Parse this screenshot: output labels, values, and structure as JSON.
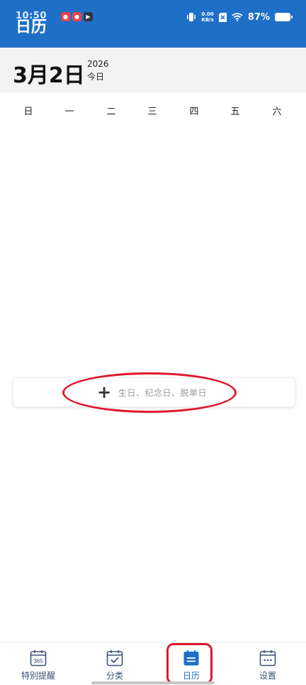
{
  "status_bar": {
    "time": "10:50",
    "net_speed": "0.00",
    "net_unit": "KB/s",
    "battery": "87%"
  },
  "app": {
    "title": "日历"
  },
  "date_header": {
    "big_date": "3月2日",
    "year": "2026",
    "today": "今日"
  },
  "weekdays": [
    "日",
    "一",
    "二",
    "三",
    "四",
    "五",
    "六"
  ],
  "add_card": {
    "plus": "+",
    "hint": "生日、纪念日、脱单日"
  },
  "bottom_nav": {
    "items": [
      {
        "label": "特别提醒",
        "icon": "calendar-365-icon"
      },
      {
        "label": "分类",
        "icon": "calendar-check-icon"
      },
      {
        "label": "日历",
        "icon": "calendar-list-icon",
        "active": true
      },
      {
        "label": "设置",
        "icon": "calendar-dots-icon"
      }
    ]
  },
  "colors": {
    "brand": "#1e6fc7",
    "annotation": "#e0172b",
    "nav_label": "#3d5277"
  }
}
